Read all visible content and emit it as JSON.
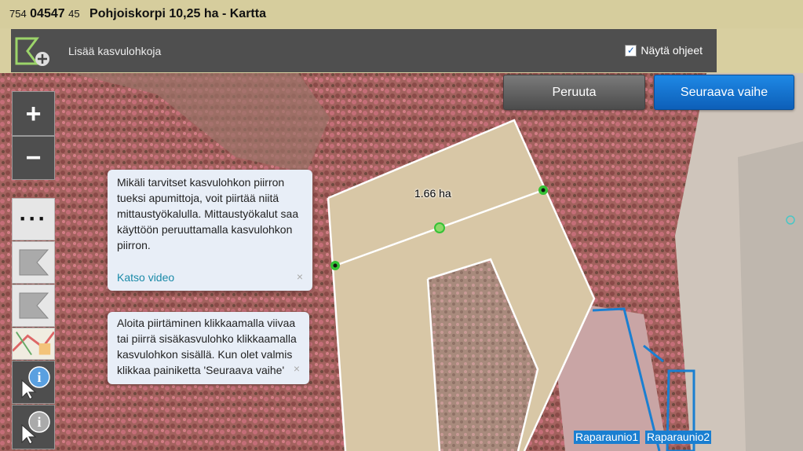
{
  "header": {
    "code_prefix": "754",
    "code_main": "04547",
    "code_suffix": "45",
    "title": "Pohjoiskorpi 10,25 ha - Kartta"
  },
  "toolbar": {
    "tool_label": "Lisää kasvulohkoja",
    "help_label": "Näytä ohjeet",
    "help_checked": true
  },
  "actions": {
    "cancel_label": "Peruuta",
    "next_label": "Seuraava vaihe"
  },
  "map_controls": {
    "zoom_in": "+",
    "zoom_out": "−",
    "more": "···"
  },
  "hints": {
    "measure_hint": "Mikäli tarvitset kasvulohkon piirron tueksi apumittoja, voit piirtää niitä mittaustyökalulla. Mittaustyökalut saa käyttöön peruuttamalla kasvulohkon piirron.",
    "video_link": "Katso video",
    "draw_hint": "Aloita piirtäminen klikkaamalla viivaa tai piirrä sisäkasvulohko klikkaamalla kasvulohkon sisällä. Kun olet valmis klikkaa painiketta 'Seuraava vaihe'",
    "close": "×"
  },
  "map": {
    "area_label": "1.66 ha",
    "parcels": [
      "Raparaunio1",
      "Raparaunio2"
    ]
  },
  "colors": {
    "accent_blue": "#1a7fd1",
    "field_fill": "#d8c7a6",
    "vertex_green": "#35c235"
  }
}
